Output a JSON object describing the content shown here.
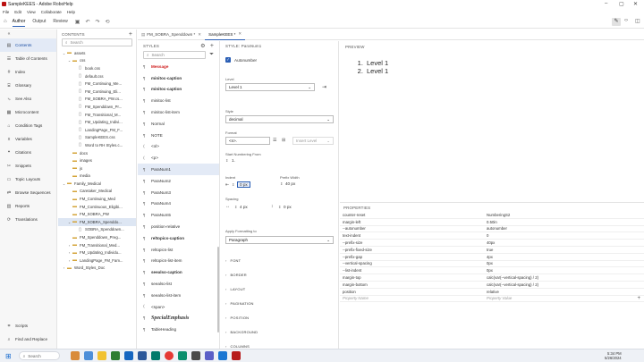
{
  "window": {
    "title": "SampleKEES - Adobe RoboHelp"
  },
  "menu": [
    "File",
    "Edit",
    "View",
    "Collaborate",
    "Help"
  ],
  "ribbon": {
    "tabs": [
      "Author",
      "Output",
      "Review"
    ],
    "active_tab": "Author"
  },
  "leftnav": {
    "items": [
      {
        "label": "Contents",
        "icon": "contents-icon",
        "active": true
      },
      {
        "label": "Table of Contents",
        "icon": "toc-icon"
      },
      {
        "label": "Index",
        "icon": "index-icon"
      },
      {
        "label": "Glossary",
        "icon": "glossary-icon"
      },
      {
        "label": "See Also",
        "icon": "see-also-icon"
      },
      {
        "label": "Microcontent",
        "icon": "microcontent-icon"
      },
      {
        "label": "Condition Tags",
        "icon": "tag-icon"
      },
      {
        "label": "Variables",
        "icon": "variables-icon"
      },
      {
        "label": "Citations",
        "icon": "citations-icon"
      },
      {
        "label": "Snippets",
        "icon": "snippets-icon"
      },
      {
        "label": "Topic Layouts",
        "icon": "layouts-icon"
      },
      {
        "label": "Browse Sequences",
        "icon": "browse-icon"
      },
      {
        "label": "Reports",
        "icon": "reports-icon"
      },
      {
        "label": "Translations",
        "icon": "translations-icon"
      }
    ],
    "bottom": [
      {
        "label": "Scripts",
        "icon": "scripts-icon"
      },
      {
        "label": "Find and Replace",
        "icon": "find-icon"
      }
    ]
  },
  "contents": {
    "header": "CONTENTS",
    "search_placeholder": "Search",
    "tree": [
      {
        "label": "assets",
        "level": 0,
        "type": "folder",
        "twisty": "v"
      },
      {
        "label": "css",
        "level": 1,
        "type": "folder",
        "twisty": "v"
      },
      {
        "label": "book.css",
        "level": 2,
        "type": "file"
      },
      {
        "label": "default.css",
        "level": 2,
        "type": "file"
      },
      {
        "label": "FM_Continuing_Me...",
        "level": 2,
        "type": "file"
      },
      {
        "label": "FM_Continuing_Eli...",
        "level": 2,
        "type": "file"
      },
      {
        "label": "FM_SOBRA_PW.cs...",
        "level": 2,
        "type": "file"
      },
      {
        "label": "FM_Spenddown_Pr...",
        "level": 2,
        "type": "file"
      },
      {
        "label": "FM_Transitional_M...",
        "level": 2,
        "type": "file"
      },
      {
        "label": "FM_Updating_Indivi...",
        "level": 2,
        "type": "file"
      },
      {
        "label": "LandingPage_FM_F...",
        "level": 2,
        "type": "file"
      },
      {
        "label": "SampleKEES.css",
        "level": 2,
        "type": "file"
      },
      {
        "label": "Word to RH Styles.c...",
        "level": 2,
        "type": "file"
      },
      {
        "label": "docs",
        "level": 1,
        "type": "folder"
      },
      {
        "label": "images",
        "level": 1,
        "type": "folder"
      },
      {
        "label": "js",
        "level": 1,
        "type": "folder"
      },
      {
        "label": "media",
        "level": 1,
        "type": "folder"
      },
      {
        "label": "Family_Medical",
        "level": 0,
        "type": "folder",
        "twisty": "v"
      },
      {
        "label": "Caretaker_Medical",
        "level": 1,
        "type": "folder"
      },
      {
        "label": "FM_Continuing_Med",
        "level": 1,
        "type": "folder"
      },
      {
        "label": "FM_Continuous_Eligibi...",
        "level": 1,
        "type": "folder"
      },
      {
        "label": "FM_SOBRA_PW",
        "level": 1,
        "type": "folder"
      },
      {
        "label": "FM_SOBRA_Spenddo...",
        "level": 1,
        "type": "folder",
        "twisty": "v",
        "selected": true
      },
      {
        "label": "SOBRA_Spenddown...",
        "level": 2,
        "type": "file"
      },
      {
        "label": "FM_Spenddown_Preg...",
        "level": 1,
        "type": "folder"
      },
      {
        "label": "FM_Transitional_Med...",
        "level": 1,
        "type": "folder",
        "twisty": ">"
      },
      {
        "label": "FM_Updating_Individu...",
        "level": 1,
        "type": "folder",
        "twisty": ">"
      },
      {
        "label": "LandingPage_FM_Fam...",
        "level": 1,
        "type": "folder",
        "twisty": ">"
      },
      {
        "label": "Word_Styles_Doc",
        "level": 0,
        "type": "folder",
        "twisty": ">"
      }
    ]
  },
  "tabs": [
    {
      "label": "FM_SOBRA_Spenddown *",
      "active": false
    },
    {
      "label": "SampleKEES *",
      "active": true
    }
  ],
  "styles": {
    "header": "STYLES",
    "search_placeholder": "Search",
    "items": [
      {
        "label": "Message",
        "color": "#d02020",
        "bold": true
      },
      {
        "label": "minitoc-caption",
        "bold": true
      },
      {
        "label": "minitoc-caption",
        "bold": true
      },
      {
        "label": "minitoc-list"
      },
      {
        "label": "minitoc-list-item"
      },
      {
        "label": "Normal"
      },
      {
        "label": "NOTE"
      },
      {
        "label": "<ol>"
      },
      {
        "label": "<p>"
      },
      {
        "label": "ParaNum1",
        "selected": true
      },
      {
        "label": "ParaNum2"
      },
      {
        "label": "ParaNum3"
      },
      {
        "label": "ParaNum4"
      },
      {
        "label": "ParaNum5"
      },
      {
        "label": "position-relative"
      },
      {
        "label": "reltopics-caption",
        "bold": true
      },
      {
        "label": "reltopics-list"
      },
      {
        "label": "reltopics-list-item"
      },
      {
        "label": "seealso-caption",
        "bold": true
      },
      {
        "label": "seealso-list"
      },
      {
        "label": "seealso-list-item"
      },
      {
        "label": "<span>"
      },
      {
        "label": "SpecialEmphasis",
        "italic": true,
        "bold": true
      },
      {
        "label": "TableHeading"
      }
    ]
  },
  "styleprops": {
    "header": "STYLE: ParaNum1",
    "autonumber_label": "Autonumber",
    "level_label": "Level",
    "level_value": "Level 1",
    "style_label": "Style",
    "style_value": "decimal",
    "format_label": "Format",
    "format_value": "<n>.",
    "insert_level": "Insert Level",
    "start_label": "Start Numbering From",
    "start_value": "1.",
    "indent_label": "Indent",
    "indent_value": "0 px",
    "prefix_label": "Prefix Width",
    "prefix_value": "40 px",
    "spacing_label": "Spacing",
    "spacing_h": "4 px",
    "spacing_v": "0 px",
    "apply_label": "Apply Formatting to",
    "apply_value": "Paragraph",
    "sections": [
      "FONT",
      "BORDER",
      "LAYOUT",
      "PAGINATION",
      "POSITION",
      "BACKGROUND",
      "COLUMNS"
    ]
  },
  "preview": {
    "header": "PREVIEW",
    "items": [
      "Level 1",
      "Level 1"
    ]
  },
  "properties": {
    "header": "PROPERTIES",
    "rows": [
      {
        "k": "counter-reset",
        "v": "NumberingS2"
      },
      {
        "k": "margin-left",
        "v": "0.50in"
      },
      {
        "k": "--autonumber",
        "v": "autonumber"
      },
      {
        "k": "text-indent",
        "v": "0"
      },
      {
        "k": "--prefix-size",
        "v": "40px"
      },
      {
        "k": "--prefix-fixed-size",
        "v": "true"
      },
      {
        "k": "--prefix-gap",
        "v": "4px"
      },
      {
        "k": "--vertical-spacing",
        "v": "0px"
      },
      {
        "k": "--list-indent",
        "v": "0px"
      },
      {
        "k": "margin-top",
        "v": "calc(var(--vertical-spacing) / 2)"
      },
      {
        "k": "margin-bottom",
        "v": "calc(var(--vertical-spacing) / 2)"
      },
      {
        "k": "position",
        "v": "relative"
      }
    ],
    "name_placeholder": "Property Name",
    "value_placeholder": "Property Value"
  },
  "taskbar": {
    "search_placeholder": "Search",
    "time": "5:34 PM",
    "date": "5/26/2024"
  },
  "colors": {
    "accent": "#2b5fb5",
    "message_red": "#d02020",
    "selection": "#e3eaf6"
  }
}
